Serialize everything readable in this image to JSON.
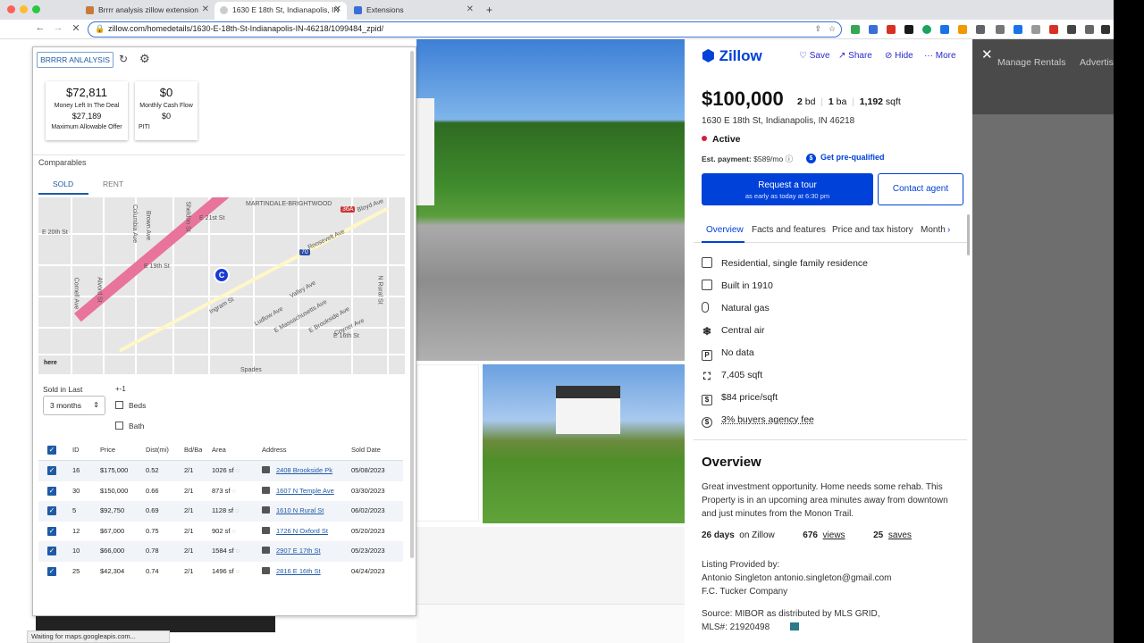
{
  "browser": {
    "tabs": [
      {
        "label": "Brrrr analysis zillow extension"
      },
      {
        "label": "1630 E 18th St, Indianapolis, IN"
      },
      {
        "label": "Extensions"
      }
    ],
    "new_tab": "+",
    "url": "zillow.com/homedetails/1630-E-18th-St-Indianapolis-IN-46218/1099484_zpid/",
    "status": "Waiting for maps.googleapis.com..."
  },
  "extension": {
    "button": "BRRRR ANLALYSIS",
    "cards": {
      "money_left": {
        "value": "$72,811",
        "label": "Money Left In The Deal",
        "sub_value": "$27,189",
        "sub_label": "Maximum Allowable Offer"
      },
      "cash_flow": {
        "value": "$0",
        "label": "Monthly Cash Flow",
        "sub_value": "$0",
        "sub_label": "PITI"
      }
    },
    "comparables_title": "Comparables",
    "tabs": {
      "sold": "SOLD",
      "rent": "RENT"
    },
    "map_labels": {
      "brightwood": "MARTINDALE-BRIGHTWOOD",
      "e20th": "E 20th St",
      "e19th": "E 19th St",
      "e21st": "E 21st St",
      "columbia": "Columbia Ave",
      "brown": "Brown Ave",
      "sheldon": "Sheldon St",
      "roosevelt": "Roosevelt Ave",
      "bloyd": "Bloyd Ave",
      "ingram": "Ingram St",
      "valley": "Valley Ave",
      "ludlow": "Ludlow Ave",
      "massachusetts": "E Massachusetts Ave",
      "brookside": "E Brookside Ave",
      "coyner": "Coyner Ave",
      "e16th": "E 16th St",
      "nrural": "N Rural St",
      "alvord": "Alvord St",
      "cornell": "Cornell Ave",
      "spades": "Spades",
      "i70": "70",
      "i36": "36A",
      "here": "here",
      "marker": "C"
    },
    "filters": {
      "sold_in_last": "Sold in Last",
      "plus_minus": "+-1",
      "period": "3 months",
      "beds": "Beds",
      "bath": "Bath"
    },
    "table": {
      "headers": [
        "ID",
        "Price",
        "Dist(mi)",
        "Bd/Ba",
        "Area",
        "Address",
        "Sold Date"
      ],
      "rows": [
        [
          "16",
          "$175,000",
          "0.52",
          "2/1",
          "1026 sf",
          "2408 Brookside Pk",
          "05/08/2023"
        ],
        [
          "30",
          "$150,000",
          "0.66",
          "2/1",
          "873 sf",
          "1607 N Temple Ave",
          "03/30/2023"
        ],
        [
          "5",
          "$92,750",
          "0.69",
          "2/1",
          "1128 sf",
          "1610 N Rural St",
          "06/02/2023"
        ],
        [
          "12",
          "$67,000",
          "0.75",
          "2/1",
          "902 sf",
          "1726 N Oxford St",
          "05/20/2023"
        ],
        [
          "10",
          "$66,000",
          "0.78",
          "2/1",
          "1584 sf",
          "2907 E 17th St",
          "05/23/2023"
        ],
        [
          "25",
          "$42,304",
          "0.74",
          "2/1",
          "1496 sf",
          "2816 E 16th St",
          "04/24/2023"
        ]
      ]
    }
  },
  "zillow": {
    "logo": "Zillow",
    "actions": {
      "save": "Save",
      "share": "Share",
      "hide": "Hide",
      "more": "More"
    },
    "price": "$100,000",
    "beds": "2",
    "beds_unit": "bd",
    "baths": "1",
    "baths_unit": "ba",
    "sqft": "1,192",
    "sqft_unit": "sqft",
    "address": "1630 E 18th St, Indianapolis, IN 46218",
    "status": "Active",
    "est_payment_label": "Est. payment:",
    "est_payment": "$589/mo",
    "prequal": "Get pre-qualified",
    "tour_button": "Request a tour",
    "tour_sub": "as early as today at 6:30 pm",
    "contact_button": "Contact agent",
    "tabs": [
      "Overview",
      "Facts and features",
      "Price and tax history",
      "Monthl"
    ],
    "facts": [
      {
        "icon": "building-icon",
        "text": "Residential, single family residence"
      },
      {
        "icon": "calendar-icon",
        "text": "Built in 1910"
      },
      {
        "icon": "thermometer-icon",
        "text": "Natural gas"
      },
      {
        "icon": "snowflake-icon",
        "text": "Central air"
      },
      {
        "icon": "parking-icon",
        "text": "No data"
      },
      {
        "icon": "lot-icon",
        "text": "7,405 sqft"
      },
      {
        "icon": "price-tag-icon",
        "text": "$84 price/sqft"
      },
      {
        "icon": "dollar-circle-icon",
        "text": "3% buyers agency fee"
      }
    ],
    "overview_title": "Overview",
    "description": "Great investment opportunity. Home needs some rehab. This Property is in an upcoming area minutes away from downtown and just minutes from the Monon Trail.",
    "stats": {
      "days": "26 days",
      "days_label": "on Zillow",
      "views": "676",
      "views_label": "views",
      "saves": "25",
      "saves_label": "saves"
    },
    "listing_label": "Listing Provided by:",
    "agent": "Antonio Singleton antonio.singleton@gmail.com",
    "brokerage": "F.C. Tucker Company",
    "source": "Source: MIBOR as distributed by MLS GRID,",
    "mls": "MLS#: 21920498"
  },
  "overlay": {
    "manage": "Manage Rentals",
    "advertise": "Advertis"
  },
  "colors": {
    "zillow_blue": "#0041d9",
    "ext_blue": "#1e5aa6",
    "highway": "#e8749c",
    "active_red": "#d31f3b"
  }
}
